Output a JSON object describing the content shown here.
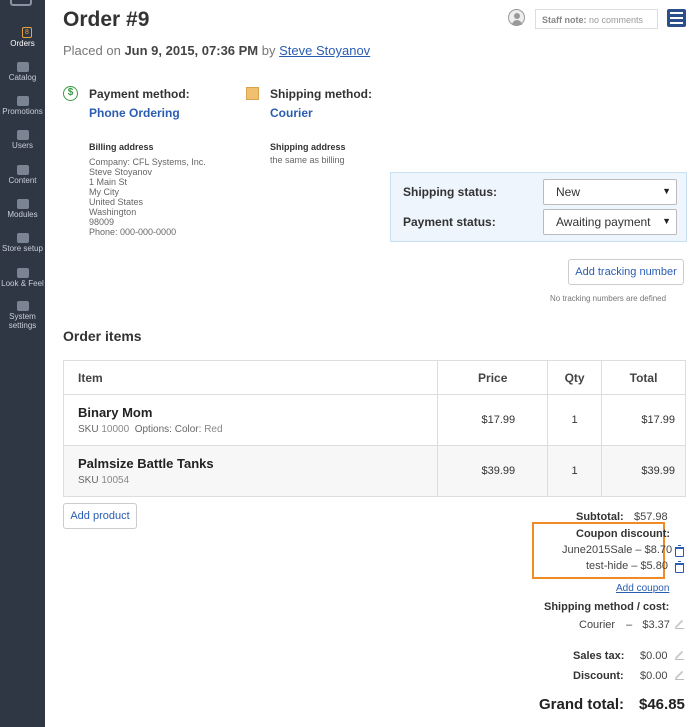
{
  "sidebar": {
    "items": [
      {
        "label": "Orders",
        "badge": "8",
        "icon": "orders-icon"
      },
      {
        "label": "Catalog",
        "icon": "tag-icon"
      },
      {
        "label": "Promotions",
        "icon": "promotions-icon"
      },
      {
        "label": "Users",
        "icon": "users-icon"
      },
      {
        "label": "Content",
        "icon": "content-icon"
      },
      {
        "label": "Modules",
        "icon": "puzzle-icon"
      },
      {
        "label": "Store setup",
        "icon": "store-icon"
      },
      {
        "label": "Look & Feel",
        "icon": "image-icon"
      },
      {
        "label": "System",
        "label2": "settings",
        "icon": "gear-icon"
      }
    ]
  },
  "header": {
    "title": "Order #9",
    "placed_prefix": "Placed on",
    "placed_date": "Jun 9, 2015, 07:36 PM",
    "placed_by": "by",
    "customer": "Steve Stoyanov",
    "staff_note_label": "Staff note:",
    "staff_note_value": "no comments"
  },
  "payment": {
    "label": "Payment method:",
    "value": "Phone Ordering"
  },
  "shipping": {
    "label": "Shipping method:",
    "value": "Courier"
  },
  "billing_address": {
    "heading": "Billing address",
    "lines": [
      "Company: CFL Systems, Inc.",
      "Steve Stoyanov",
      "1 Main St",
      "My City",
      "United States",
      "Washington",
      "98009",
      "Phone: 000-000-0000"
    ]
  },
  "shipping_address": {
    "heading": "Shipping address",
    "line": "the same as billing"
  },
  "statuses": {
    "shipping_label": "Shipping status:",
    "shipping_value": "New",
    "payment_label": "Payment status:",
    "payment_value": "Awaiting payment"
  },
  "tracking": {
    "button": "Add tracking number",
    "empty": "No tracking numbers are defined"
  },
  "order_items": {
    "title": "Order items",
    "columns": [
      "Item",
      "Price",
      "Qty",
      "Total"
    ],
    "rows": [
      {
        "name": "Binary Mom",
        "sku_label": "SKU",
        "sku": "10000",
        "options_label": "Options: Color:",
        "options_value": "Red",
        "price": "$17.99",
        "qty": "1",
        "total": "$17.99"
      },
      {
        "name": "Palmsize Battle Tanks",
        "sku_label": "SKU",
        "sku": "10054",
        "price": "$39.99",
        "qty": "1",
        "total": "$39.99"
      }
    ],
    "add_product": "Add product"
  },
  "totals": {
    "subtotal_label": "Subtotal:",
    "subtotal": "$57.98",
    "coupon_label": "Coupon discount:",
    "coupons": [
      {
        "code": "June2015Sale",
        "amount": "– $8.70"
      },
      {
        "code": "test-hide",
        "amount": "– $5.80"
      }
    ],
    "add_coupon": "Add coupon",
    "shipping_label": "Shipping method / cost:",
    "shipping_method": "Courier",
    "shipping_dash": "–",
    "shipping_cost": "$3.37",
    "tax_label": "Sales tax:",
    "tax": "$0.00",
    "discount_label": "Discount:",
    "discount": "$0.00",
    "grand_label": "Grand total:",
    "grand": "$46.85"
  },
  "colors": {
    "accent": "#2a5db0",
    "highlight": "#f08a24",
    "sidebar": "#2f3744"
  }
}
